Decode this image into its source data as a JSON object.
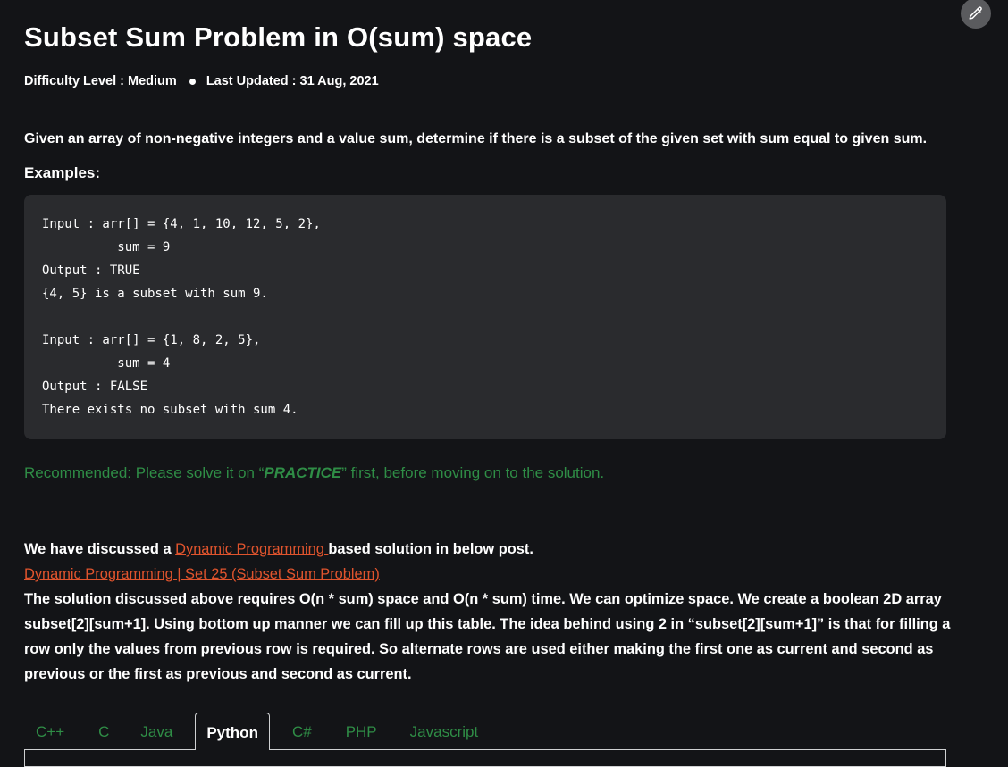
{
  "article": {
    "title": "Subset Sum Problem in O(sum) space",
    "difficulty": "Difficulty Level : Medium",
    "last_updated": "Last Updated : 31 Aug, 2021",
    "intro": "Given an array of non-negative integers and a value sum, determine if there is a subset of the given set with sum equal to given sum.",
    "examples_label": "Examples:"
  },
  "code_example": {
    "lines": [
      "Input : arr[] = {4, 1, 10, 12, 5, 2},",
      "          sum = 9",
      "Output : TRUE",
      "{4, 5} is a subset with sum 9.",
      "",
      "Input : arr[] = {1, 8, 2, 5},",
      "          sum = 4",
      "Output : FALSE",
      "There exists no subset with sum 4."
    ]
  },
  "recommendation": {
    "prefix": "Recommended: Please solve it on “",
    "practice": "PRACTICE",
    "suffix": "” first, before moving on to the solution."
  },
  "body": {
    "p1_before": "We have discussed a ",
    "p1_link": "Dynamic Programming ",
    "p1_after": "based solution in below post.",
    "post_link": "Dynamic Programming | Set 25 (Subset Sum Problem)",
    "line3": "The solution discussed above requires O(n * sum) space and O(n * sum) time. We can optimize space. We create a boolean 2D array",
    "line4": "subset[2][sum+1]. Using bottom up manner we can fill up this table. The idea behind using 2 in “subset[2][sum+1]” is that for filling a",
    "line5": "row only the values from previous row is required. So alternate rows are used either making the first one as current and second as",
    "line6": "previous or the first as previous and second as current."
  },
  "tabs": [
    {
      "label": "C++",
      "active": false
    },
    {
      "label": "C",
      "active": false
    },
    {
      "label": "Java",
      "active": false
    },
    {
      "label": "Python",
      "active": true
    },
    {
      "label": "C#",
      "active": false
    },
    {
      "label": "PHP",
      "active": false
    },
    {
      "label": "Javascript",
      "active": false
    }
  ],
  "icons": {
    "edit": "pencil-icon"
  },
  "colors": {
    "background": "#131417",
    "code_background": "#2a2b2e",
    "link_green": "#2f8d46",
    "link_orange": "#e0542d"
  }
}
